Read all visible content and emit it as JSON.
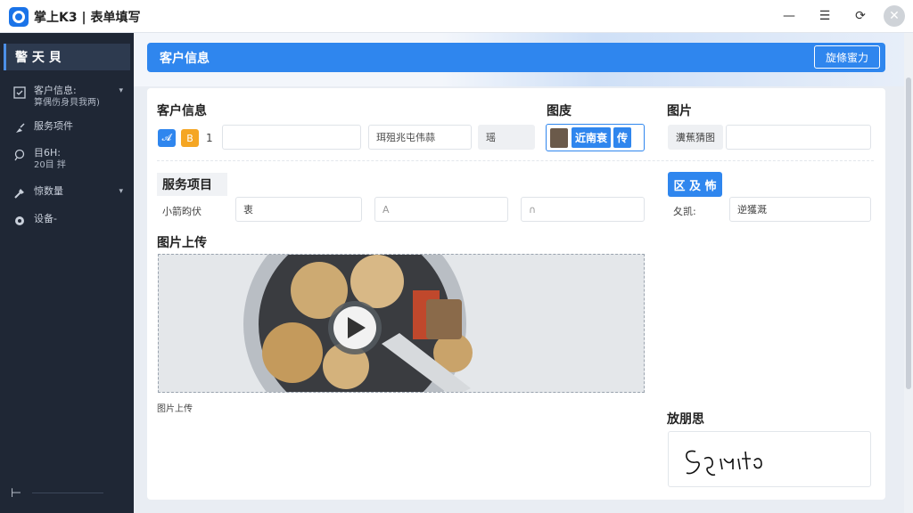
{
  "window": {
    "title": "掌上K3 | 表单填写",
    "buttons": {
      "minimize": "—",
      "menu": "☰",
      "restore": "⟳",
      "close": "✕"
    }
  },
  "sidebar": {
    "header": "警 天 貝",
    "items": [
      {
        "icon": "checklist-icon",
        "label": "客户信息:",
        "sub": "算偶伤身貝我两)",
        "caret": "▾"
      },
      {
        "icon": "brush-icon",
        "label": "服务项件",
        "sub": "",
        "caret": ""
      },
      {
        "icon": "pin-icon",
        "label": "目6H:",
        "sub": "20目 拌",
        "caret": ""
      },
      {
        "icon": "tools-icon",
        "label": "惊数量",
        "sub": "",
        "caret": "▾"
      },
      {
        "icon": "gear-icon",
        "label": "设备-",
        "sub": "",
        "caret": ""
      }
    ],
    "bottom": "⊢"
  },
  "header": {
    "title": "客户信息",
    "button": "旋條蜜力"
  },
  "sections": {
    "customer_info": {
      "title": "客户信息",
      "chip1": "𝓐",
      "chip2": "B",
      "count": "1",
      "field1_value": "",
      "field2_value": "珥殂兆屯伟蒜",
      "field3_value": "瑶"
    },
    "picture_a": {
      "title": "图庋",
      "avatar_text": "近南衰",
      "action": "传"
    },
    "picture_b": {
      "title": "图片",
      "label": "瀵蕉猜图",
      "value": ""
    },
    "service": {
      "title": "服务项目",
      "label": "小箭昀伏",
      "field1": "衷",
      "field2": "A ",
      "field3": "∩"
    },
    "right_action": {
      "button": "区 及 怖",
      "label": "夂凯:",
      "value": "逆獲溉"
    },
    "upload": {
      "title": "图片上传",
      "caption": "图片上传",
      "play_icon": "play-icon"
    },
    "signature": {
      "title": "放朋思",
      "text": "Sgmtro"
    }
  },
  "colors": {
    "accent": "#2f86ee",
    "sidebar": "#1f2735",
    "orange": "#f5a623"
  }
}
